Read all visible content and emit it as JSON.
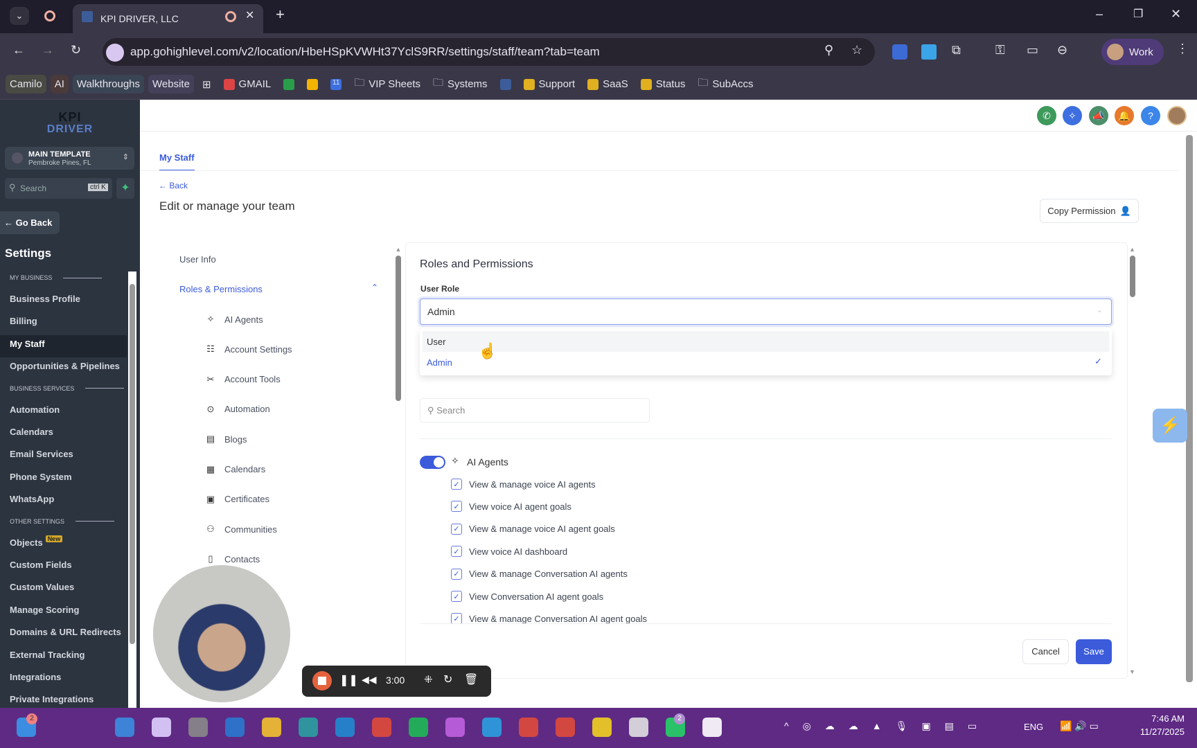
{
  "browser": {
    "tab_title": "KPI DRIVER, LLC",
    "url": "app.gohighlevel.com/v2/location/HbeHSpKVWHt37YclS9RR/settings/staff/team?tab=team",
    "profile": "Work",
    "bookmarks": [
      {
        "label": "Camilo"
      },
      {
        "label": "AI"
      },
      {
        "label": "Walkthroughs"
      },
      {
        "label": "Website"
      },
      {
        "label": "GMAIL"
      },
      {
        "label": "11"
      },
      {
        "label": "VIP Sheets"
      },
      {
        "label": "Systems"
      },
      {
        "label": "Support"
      },
      {
        "label": "SaaS"
      },
      {
        "label": "Status"
      },
      {
        "label": "SubAccs"
      }
    ]
  },
  "sidebar": {
    "logo": "KPI DRIVER",
    "location_name": "MAIN TEMPLATE",
    "location_sub": "Pembroke Pines, FL",
    "search_placeholder": "Search",
    "search_shortcut": "ctrl K",
    "go_back": "Go Back",
    "settings_title": "Settings",
    "sections": [
      {
        "header": "MY BUSINESS",
        "items": [
          "Business Profile",
          "Billing",
          "My Staff",
          "Opportunities & Pipelines"
        ]
      },
      {
        "header": "BUSINESS SERVICES",
        "items": [
          "Automation",
          "Calendars",
          "Email Services",
          "Phone System",
          "WhatsApp"
        ]
      },
      {
        "header": "OTHER SETTINGS",
        "items": [
          "Objects",
          "Custom Fields",
          "Custom Values",
          "Manage Scoring",
          "Domains & URL Redirects",
          "External Tracking",
          "Integrations",
          "Private Integrations"
        ]
      }
    ],
    "active": "My Staff",
    "new_badge": "New"
  },
  "page": {
    "tab": "My Staff",
    "back": "Back",
    "title": "Edit or manage your team",
    "copy_permission": "Copy Permission"
  },
  "subnav": {
    "user_info": "User Info",
    "roles": "Roles & Permissions",
    "items": [
      "AI Agents",
      "Account Settings",
      "Account Tools",
      "Automation",
      "Blogs",
      "Calendars",
      "Certificates",
      "Communities",
      "Contacts"
    ]
  },
  "roles": {
    "title": "Roles and Permissions",
    "user_role_label": "User Role",
    "selected": "Admin",
    "options": [
      "User",
      "Admin"
    ],
    "search_placeholder": "Search",
    "group": {
      "name": "AI Agents",
      "enabled": true,
      "permissions": [
        "View & manage voice AI agents",
        "View voice AI agent goals",
        "View & manage voice AI agent goals",
        "View voice AI dashboard",
        "View & manage Conversation AI agents",
        "View Conversation AI agent goals",
        "View & manage Conversation AI agent goals"
      ]
    },
    "cancel": "Cancel",
    "save": "Save"
  },
  "recorder": {
    "time": "3:00"
  },
  "taskbar": {
    "lang": "ENG",
    "time": "7:46 AM",
    "date": "11/27/2025",
    "badge_left": "2",
    "badge_whatsapp": "2"
  },
  "colors": {
    "accent": "#3b5bdb",
    "sidebar": "#2c3440",
    "taskbar": "#5e2a84"
  }
}
